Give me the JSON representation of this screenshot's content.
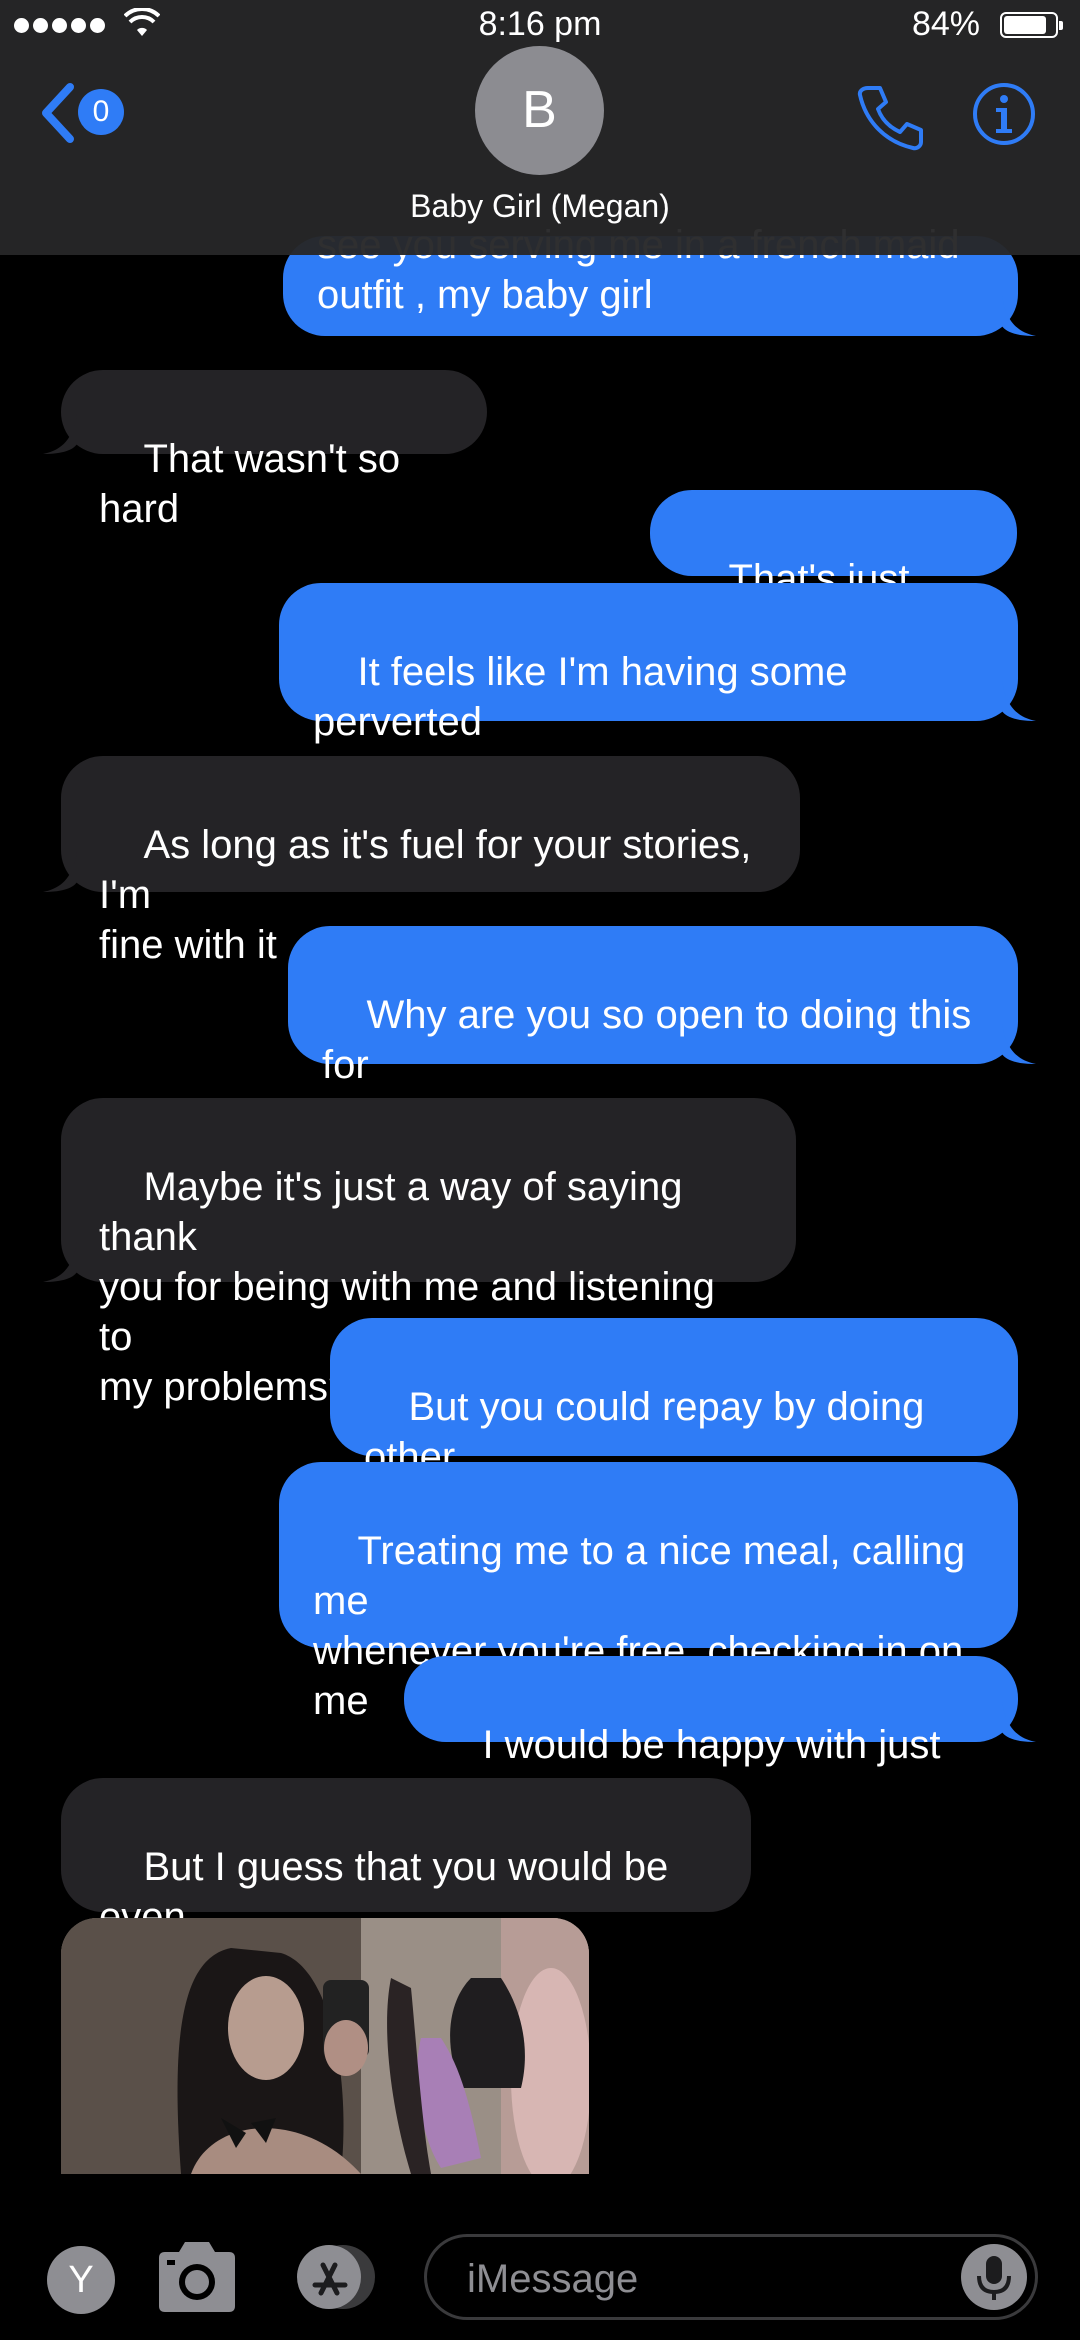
{
  "status_bar": {
    "time": "8:16 pm",
    "battery_percent_label": "84%",
    "battery_level": 0.84
  },
  "nav": {
    "back_badge": "0",
    "avatar_initial": "B",
    "contact_name": "Baby Girl (Megan)",
    "phone_icon": "phone-icon",
    "info_icon": "info-icon"
  },
  "messages": [
    {
      "side": "out",
      "text": "see you serving me in a french maid\noutfit , my baby girl"
    },
    {
      "side": "in",
      "text": "That wasn't so hard"
    },
    {
      "side": "out",
      "text": "That's just weird"
    },
    {
      "side": "out",
      "text": "It feels like I'm having some perverted\nthoughts about you"
    },
    {
      "side": "in",
      "text": "As long as it's fuel for your stories, I'm\nfine with it"
    },
    {
      "side": "out",
      "text": "Why are you so open to doing this for\nme?"
    },
    {
      "side": "in",
      "text": "Maybe it's just a way of saying thank\nyou for being with me and listening to\nmy problems?"
    },
    {
      "side": "out",
      "text": "But you could repay by doing other\nstuff"
    },
    {
      "side": "out",
      "text": "Treating me to a nice meal, calling me\nwhenever you're free, checking in on\nme"
    },
    {
      "side": "out",
      "text": "I would be happy with just that"
    },
    {
      "side": "in",
      "text": "But I guess that you would be even\nhappier with seeing this?"
    }
  ],
  "photo_message": {
    "side": "in",
    "content": "mirror selfie photo"
  },
  "input_bar": {
    "app_initial": "Y",
    "placeholder": "iMessage",
    "icons": [
      "camera-icon",
      "app-store-icon",
      "microphone-icon"
    ]
  },
  "colors": {
    "outgoing": "#2f7cf6",
    "incoming": "#242326",
    "background": "#000000",
    "header": "#262628"
  }
}
